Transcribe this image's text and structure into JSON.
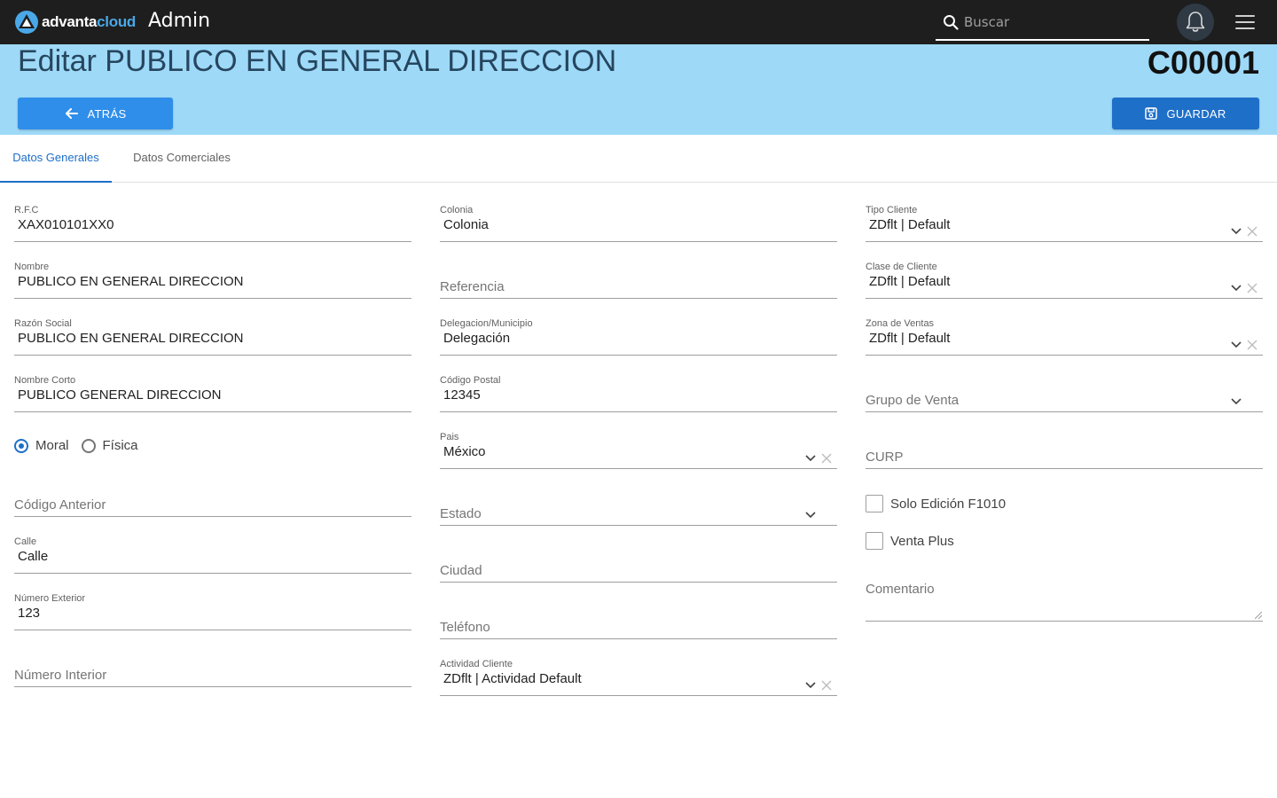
{
  "topbar": {
    "logo_part1": "advanta",
    "logo_part2": "cloud",
    "app_title": "Admin",
    "search_placeholder": "Buscar",
    "bell_icon": "bell-icon",
    "menu_icon": "hamburger-icon"
  },
  "header": {
    "title": "Editar PUBLICO EN GENERAL DIRECCION",
    "record_code": "C00001",
    "back_label": "ATRÁS",
    "save_label": "GUARDAR"
  },
  "tabs": [
    {
      "label": "Datos Generales",
      "active": true
    },
    {
      "label": "Datos Comerciales",
      "active": false
    }
  ],
  "col1": {
    "rfc": {
      "label": "R.F.C",
      "value": "XAX010101XX0"
    },
    "nombre": {
      "label": "Nombre",
      "value": "PUBLICO EN GENERAL DIRECCION"
    },
    "razon_social": {
      "label": "Razón Social",
      "value": "PUBLICO EN GENERAL DIRECCION"
    },
    "nombre_corto": {
      "label": "Nombre Corto",
      "value": "PUBLICO GENERAL DIRECCION"
    },
    "persona": {
      "options": [
        "Moral",
        "Física"
      ],
      "selected": "Moral"
    },
    "codigo_anterior": {
      "placeholder": "Código Anterior"
    },
    "calle": {
      "label": "Calle",
      "value": "Calle"
    },
    "numero_exterior": {
      "label": "Número Exterior",
      "value": "123"
    },
    "numero_interior": {
      "placeholder": "Número Interior"
    }
  },
  "col2": {
    "colonia": {
      "label": "Colonia",
      "value": "Colonia"
    },
    "referencia": {
      "placeholder": "Referencia"
    },
    "delegacion": {
      "label": "Delegacion/Municipio",
      "value": "Delegación"
    },
    "codigo_postal": {
      "label": "Código Postal",
      "value": "12345"
    },
    "pais": {
      "label": "Pais",
      "value": "México"
    },
    "estado": {
      "placeholder": "Estado"
    },
    "ciudad": {
      "placeholder": "Ciudad"
    },
    "telefono": {
      "placeholder": "Teléfono"
    },
    "actividad_cliente": {
      "label": "Actividad Cliente",
      "value": "ZDflt | Actividad Default"
    }
  },
  "col3": {
    "tipo_cliente": {
      "label": "Tipo Cliente",
      "value": "ZDflt | Default"
    },
    "clase_cliente": {
      "label": "Clase de Cliente",
      "value": "ZDflt | Default"
    },
    "zona_ventas": {
      "label": "Zona de Ventas",
      "value": "ZDflt | Default"
    },
    "grupo_venta": {
      "placeholder": "Grupo de Venta"
    },
    "curp": {
      "placeholder": "CURP"
    },
    "solo_edicion": {
      "label": "Solo Edición F1010",
      "checked": false
    },
    "venta_plus": {
      "label": "Venta Plus",
      "checked": false
    },
    "comentario": {
      "placeholder": "Comentario"
    }
  },
  "colors": {
    "topbar_bg": "#1e1e1e",
    "band_bg": "#9ed9f8",
    "primary": "#1e6fc8",
    "back_button": "#2f8eea"
  }
}
